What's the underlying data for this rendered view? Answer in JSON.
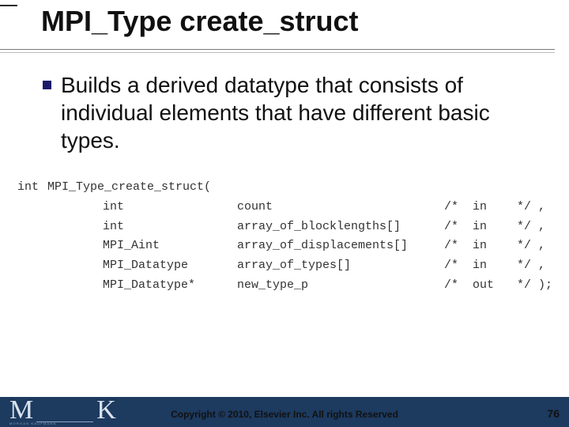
{
  "title": "MPI_Type create_struct",
  "bullet": "Builds a derived datatype that consists of individual elements that have different basic types.",
  "code": {
    "header_lead": "int",
    "header_rest": "MPI_Type_create_struct(",
    "rows": [
      {
        "type": "int",
        "name": "count",
        "comment": "/*  in",
        "tail": "*/ ,"
      },
      {
        "type": "int",
        "name": "array_of_blocklengths[]",
        "comment": "/*  in",
        "tail": "*/ ,"
      },
      {
        "type": "MPI_Aint",
        "name": "array_of_displacements[]",
        "comment": "/*  in",
        "tail": "*/ ,"
      },
      {
        "type": "MPI_Datatype",
        "name": "array_of_types[]",
        "comment": "/*  in",
        "tail": "*/ ,"
      },
      {
        "type": "MPI_Datatype*",
        "name": "new_type_p",
        "comment": "/*  out",
        "tail": "*/ );"
      }
    ]
  },
  "footer": {
    "logo_m": "M",
    "logo_k": "K",
    "logo_sub": "MORGAN KAUFMANN",
    "copyright": "Copyright © 2010, Elsevier Inc. All rights Reserved",
    "page": "76"
  }
}
